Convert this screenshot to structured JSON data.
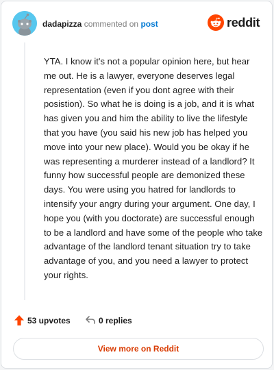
{
  "header": {
    "username": "dadapizza",
    "action": "commented on",
    "target": "post",
    "avatar_icon": "snoo-avatar-icon",
    "brand": {
      "wordmark": "reddit",
      "icon": "reddit-logo-icon",
      "color": "#ff4500"
    }
  },
  "comment": {
    "body": "YTA. I know it's not a popular opinion here, but hear me out. He is a lawyer, everyone deserves legal representation (even if you dont agree with their posistion). So what he is doing is a job, and it is what has given you and him the ability to live the lifestyle that you have (you said his new job has helped you move into your new place). Would you be okay if he was representing a murderer instead of a landlord? It funny how successful people are demonized these days. You were using you hatred for landlords to intensify your angry during your argument. One day, I hope you (with you doctorate) are successful enough to be a landlord and have some of the people who take advantage of the landlord tenant situation try to take advantage of you, and you need a lawyer to protect your rights."
  },
  "actions": {
    "upvotes_label": "53 upvotes",
    "upvote_icon": "upvote-arrow-icon",
    "upvote_color": "#ff4500",
    "replies_label": "0 replies",
    "reply_icon": "reply-arrow-icon"
  },
  "footer": {
    "view_more_label": "View more on Reddit",
    "accent": "#d93a00"
  }
}
